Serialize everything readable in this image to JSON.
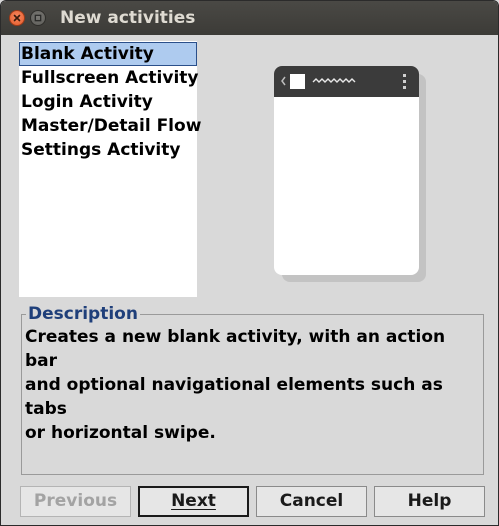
{
  "window": {
    "title": "New activities"
  },
  "activity_list": {
    "items": [
      {
        "label": "Blank Activity",
        "selected": true
      },
      {
        "label": "Fullscreen Activity",
        "selected": false
      },
      {
        "label": "Login Activity",
        "selected": false
      },
      {
        "label": "Master/Detail Flow",
        "selected": false
      },
      {
        "label": "Settings Activity",
        "selected": false
      }
    ]
  },
  "description": {
    "legend": "Description",
    "lines": [
      "Creates a new blank activity, with an action bar",
      "and optional navigational elements such as tabs",
      "or horizontal swipe."
    ]
  },
  "buttons": {
    "previous": "Previous",
    "next": "Next",
    "cancel": "Cancel",
    "help": "Help"
  },
  "colors": {
    "selection_bg": "#aecbef",
    "legend_text": "#1f3f7a",
    "titlebar": "#3c3b37",
    "close_button": "#e45d2b"
  }
}
